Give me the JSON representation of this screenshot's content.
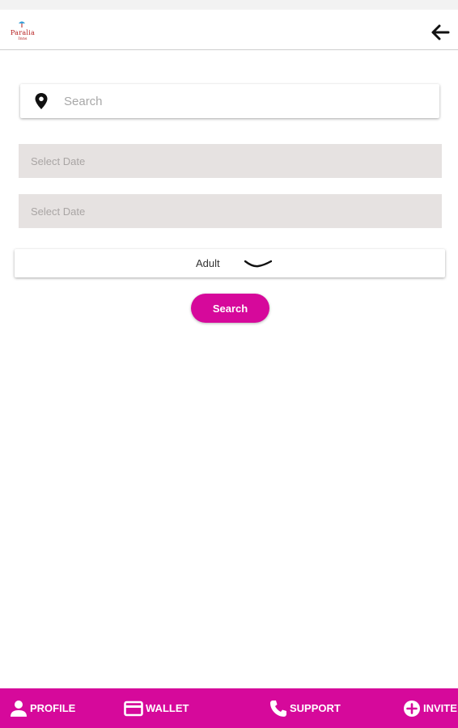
{
  "header": {
    "logo_text": "Paralia",
    "logo_sub": "Inns",
    "back_icon": "arrow-left-icon"
  },
  "search": {
    "icon": "map-pin-icon",
    "placeholder": "Search"
  },
  "dates": [
    {
      "placeholder": "Select Date"
    },
    {
      "placeholder": "Select Date"
    }
  ],
  "guests": {
    "selected": "Adult",
    "icon": "chevron-down-icon"
  },
  "search_button": {
    "label": "Search"
  },
  "bottom_nav": {
    "items": [
      {
        "label": "PROFILE",
        "icon": "person-icon"
      },
      {
        "label": "WALLET",
        "icon": "card-icon"
      },
      {
        "label": "SUPPORT",
        "icon": "phone-icon"
      },
      {
        "label": "INVITE",
        "icon": "plus-circle-icon"
      }
    ]
  },
  "colors": {
    "accent": "#d6099b",
    "field_bg": "#e6e2e1",
    "logo_red": "#b51d1d"
  }
}
